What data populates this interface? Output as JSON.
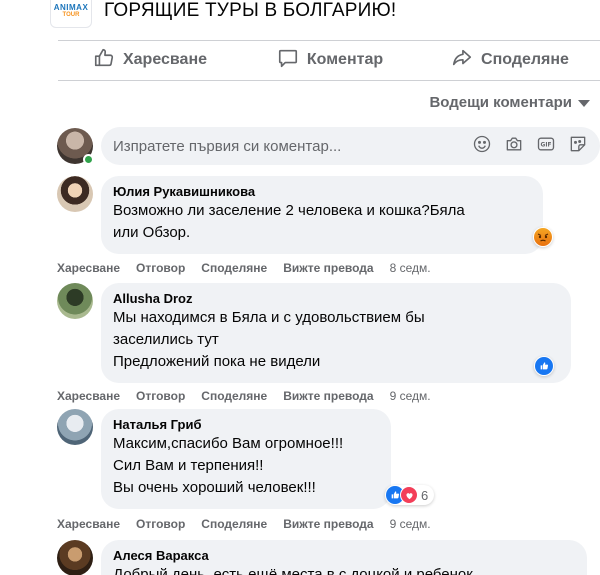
{
  "post": {
    "title": "ГОРЯЩИЕ ТУРЫ В БОЛГАРИЮ!",
    "logo_top": "ANIMAX",
    "logo_bottom": "TOUR"
  },
  "actions": {
    "like": "Харесване",
    "comment": "Коментар",
    "share": "Споделяне"
  },
  "sort": {
    "label": "Водещи коментари"
  },
  "composer": {
    "placeholder": "Изпратете първия си коментар..."
  },
  "comment_actions": {
    "like": "Харесване",
    "reply": "Отговор",
    "share": "Споделяне",
    "translate": "Вижте превода"
  },
  "comments": [
    {
      "name": "Юлия Рукавишникова",
      "lines": [
        "Возможно ли заселение 2 человека и кошка?Бяла",
        "или Обзор."
      ],
      "reaction": "angry",
      "reaction_count": "",
      "time": "8 седм."
    },
    {
      "name": "Allusha Droz",
      "lines": [
        "Мы находимся в Бяла и с удовольствием бы",
        "заселились тут",
        "Предложений пока не видели"
      ],
      "reaction": "like",
      "reaction_count": "",
      "time": "9 седм."
    },
    {
      "name": "Наталья Гриб",
      "lines": [
        "Максим,спасибо Вам огромное!!!",
        "Сил Вам и терпения!!",
        "Вы очень хороший человек!!!"
      ],
      "reaction": "like-love",
      "reaction_count": "6",
      "time": "9 седм."
    },
    {
      "name": "Алеся Варакса",
      "lines": [
        "Добрый день, есть ещё места в с доцкой и ребенок"
      ],
      "reaction": "",
      "reaction_count": "",
      "time": ""
    }
  ],
  "colors": {
    "brand_blue": "#1877f2",
    "secondary_text": "#65676b",
    "bubble_bg": "#f0f2f5",
    "online_green": "#31a24c",
    "angry_orange": "#e9710f",
    "love_red": "#f33e58"
  }
}
